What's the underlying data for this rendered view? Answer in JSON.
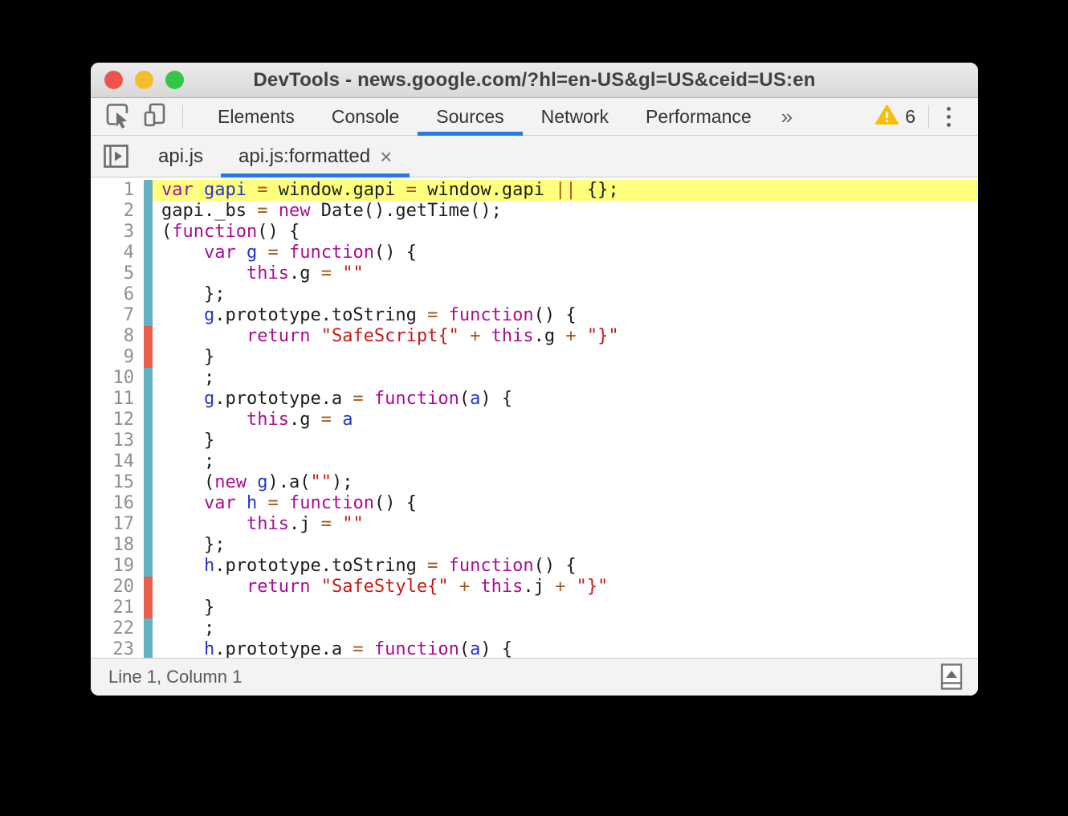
{
  "window": {
    "title": "DevTools - news.google.com/?hl=en-US&gl=US&ceid=US:en"
  },
  "toolbar": {
    "tabs": [
      "Elements",
      "Console",
      "Sources",
      "Network",
      "Performance"
    ],
    "active_tab": "Sources",
    "more_tabs_symbol": "»",
    "warning_count": "6"
  },
  "file_tabs": [
    {
      "label": "api.js",
      "active": false
    },
    {
      "label": "api.js:formatted",
      "active": true,
      "close_symbol": "×"
    }
  ],
  "editor": {
    "highlight_line": 1,
    "lines": [
      {
        "n": 1,
        "coverage": "used",
        "tokens": [
          [
            "k",
            "var"
          ],
          [
            "p",
            " "
          ],
          [
            "d",
            "gapi"
          ],
          [
            "p",
            " "
          ],
          [
            "o",
            "="
          ],
          [
            "p",
            " window.gapi "
          ],
          [
            "o",
            "="
          ],
          [
            "p",
            " window.gapi "
          ],
          [
            "o",
            "||"
          ],
          [
            "p",
            " {};"
          ]
        ]
      },
      {
        "n": 2,
        "coverage": "used",
        "tokens": [
          [
            "p",
            "gapi._bs "
          ],
          [
            "o",
            "="
          ],
          [
            "p",
            " "
          ],
          [
            "k",
            "new"
          ],
          [
            "p",
            " Date().getTime();"
          ]
        ]
      },
      {
        "n": 3,
        "coverage": "used",
        "tokens": [
          [
            "p",
            "("
          ],
          [
            "k",
            "function"
          ],
          [
            "p",
            "() {"
          ]
        ]
      },
      {
        "n": 4,
        "coverage": "used",
        "tokens": [
          [
            "p",
            "    "
          ],
          [
            "k",
            "var"
          ],
          [
            "p",
            " "
          ],
          [
            "d",
            "g"
          ],
          [
            "p",
            " "
          ],
          [
            "o",
            "="
          ],
          [
            "p",
            " "
          ],
          [
            "k",
            "function"
          ],
          [
            "p",
            "() {"
          ]
        ]
      },
      {
        "n": 5,
        "coverage": "used",
        "tokens": [
          [
            "p",
            "        "
          ],
          [
            "k",
            "this"
          ],
          [
            "p",
            ".g "
          ],
          [
            "o",
            "="
          ],
          [
            "p",
            " "
          ],
          [
            "s",
            "\"\""
          ]
        ]
      },
      {
        "n": 6,
        "coverage": "used",
        "tokens": [
          [
            "p",
            "    };"
          ]
        ]
      },
      {
        "n": 7,
        "coverage": "used",
        "tokens": [
          [
            "p",
            "    "
          ],
          [
            "d",
            "g"
          ],
          [
            "p",
            ".prototype.toString "
          ],
          [
            "o",
            "="
          ],
          [
            "p",
            " "
          ],
          [
            "k",
            "function"
          ],
          [
            "p",
            "() {"
          ]
        ]
      },
      {
        "n": 8,
        "coverage": "unused",
        "tokens": [
          [
            "p",
            "        "
          ],
          [
            "k",
            "return"
          ],
          [
            "p",
            " "
          ],
          [
            "s",
            "\"SafeScript{\""
          ],
          [
            "p",
            " "
          ],
          [
            "o",
            "+"
          ],
          [
            "p",
            " "
          ],
          [
            "k",
            "this"
          ],
          [
            "p",
            ".g "
          ],
          [
            "o",
            "+"
          ],
          [
            "p",
            " "
          ],
          [
            "s",
            "\"}\""
          ]
        ]
      },
      {
        "n": 9,
        "coverage": "unused",
        "tokens": [
          [
            "p",
            "    }"
          ]
        ]
      },
      {
        "n": 10,
        "coverage": "used",
        "tokens": [
          [
            "p",
            "    ;"
          ]
        ]
      },
      {
        "n": 11,
        "coverage": "used",
        "tokens": [
          [
            "p",
            "    "
          ],
          [
            "d",
            "g"
          ],
          [
            "p",
            ".prototype.a "
          ],
          [
            "o",
            "="
          ],
          [
            "p",
            " "
          ],
          [
            "k",
            "function"
          ],
          [
            "p",
            "("
          ],
          [
            "d",
            "a"
          ],
          [
            "p",
            ") {"
          ]
        ]
      },
      {
        "n": 12,
        "coverage": "used",
        "tokens": [
          [
            "p",
            "        "
          ],
          [
            "k",
            "this"
          ],
          [
            "p",
            ".g "
          ],
          [
            "o",
            "="
          ],
          [
            "p",
            " "
          ],
          [
            "d",
            "a"
          ]
        ]
      },
      {
        "n": 13,
        "coverage": "used",
        "tokens": [
          [
            "p",
            "    }"
          ]
        ]
      },
      {
        "n": 14,
        "coverage": "used",
        "tokens": [
          [
            "p",
            "    ;"
          ]
        ]
      },
      {
        "n": 15,
        "coverage": "used",
        "tokens": [
          [
            "p",
            "    ("
          ],
          [
            "k",
            "new"
          ],
          [
            "p",
            " "
          ],
          [
            "d",
            "g"
          ],
          [
            "p",
            ").a("
          ],
          [
            "s",
            "\"\""
          ],
          [
            "p",
            ");"
          ]
        ]
      },
      {
        "n": 16,
        "coverage": "used",
        "tokens": [
          [
            "p",
            "    "
          ],
          [
            "k",
            "var"
          ],
          [
            "p",
            " "
          ],
          [
            "d",
            "h"
          ],
          [
            "p",
            " "
          ],
          [
            "o",
            "="
          ],
          [
            "p",
            " "
          ],
          [
            "k",
            "function"
          ],
          [
            "p",
            "() {"
          ]
        ]
      },
      {
        "n": 17,
        "coverage": "used",
        "tokens": [
          [
            "p",
            "        "
          ],
          [
            "k",
            "this"
          ],
          [
            "p",
            ".j "
          ],
          [
            "o",
            "="
          ],
          [
            "p",
            " "
          ],
          [
            "s",
            "\"\""
          ]
        ]
      },
      {
        "n": 18,
        "coverage": "used",
        "tokens": [
          [
            "p",
            "    };"
          ]
        ]
      },
      {
        "n": 19,
        "coverage": "used",
        "tokens": [
          [
            "p",
            "    "
          ],
          [
            "d",
            "h"
          ],
          [
            "p",
            ".prototype.toString "
          ],
          [
            "o",
            "="
          ],
          [
            "p",
            " "
          ],
          [
            "k",
            "function"
          ],
          [
            "p",
            "() {"
          ]
        ]
      },
      {
        "n": 20,
        "coverage": "unused",
        "tokens": [
          [
            "p",
            "        "
          ],
          [
            "k",
            "return"
          ],
          [
            "p",
            " "
          ],
          [
            "s",
            "\"SafeStyle{\""
          ],
          [
            "p",
            " "
          ],
          [
            "o",
            "+"
          ],
          [
            "p",
            " "
          ],
          [
            "k",
            "this"
          ],
          [
            "p",
            ".j "
          ],
          [
            "o",
            "+"
          ],
          [
            "p",
            " "
          ],
          [
            "s",
            "\"}\""
          ]
        ]
      },
      {
        "n": 21,
        "coverage": "unused",
        "tokens": [
          [
            "p",
            "    }"
          ]
        ]
      },
      {
        "n": 22,
        "coverage": "used",
        "tokens": [
          [
            "p",
            "    ;"
          ]
        ]
      },
      {
        "n": 23,
        "coverage": "used",
        "tokens": [
          [
            "p",
            "    "
          ],
          [
            "d",
            "h"
          ],
          [
            "p",
            ".prototype.a "
          ],
          [
            "o",
            "="
          ],
          [
            "p",
            " "
          ],
          [
            "k",
            "function"
          ],
          [
            "p",
            "("
          ],
          [
            "d",
            "a"
          ],
          [
            "p",
            ") {"
          ]
        ]
      }
    ]
  },
  "status_bar": {
    "text": "Line 1, Column 1"
  },
  "colors": {
    "accent_blue": "#2878e8",
    "warning_amber": "#fbbc05",
    "coverage_used_teal": "#65b1c1",
    "coverage_unused_red": "#e8604c",
    "line_highlight_yellow": "#ffff7e",
    "syntax_keyword": "#aa0d91",
    "syntax_definition": "#2433cc",
    "syntax_operator": "#a4581c",
    "syntax_string": "#c41a16"
  }
}
